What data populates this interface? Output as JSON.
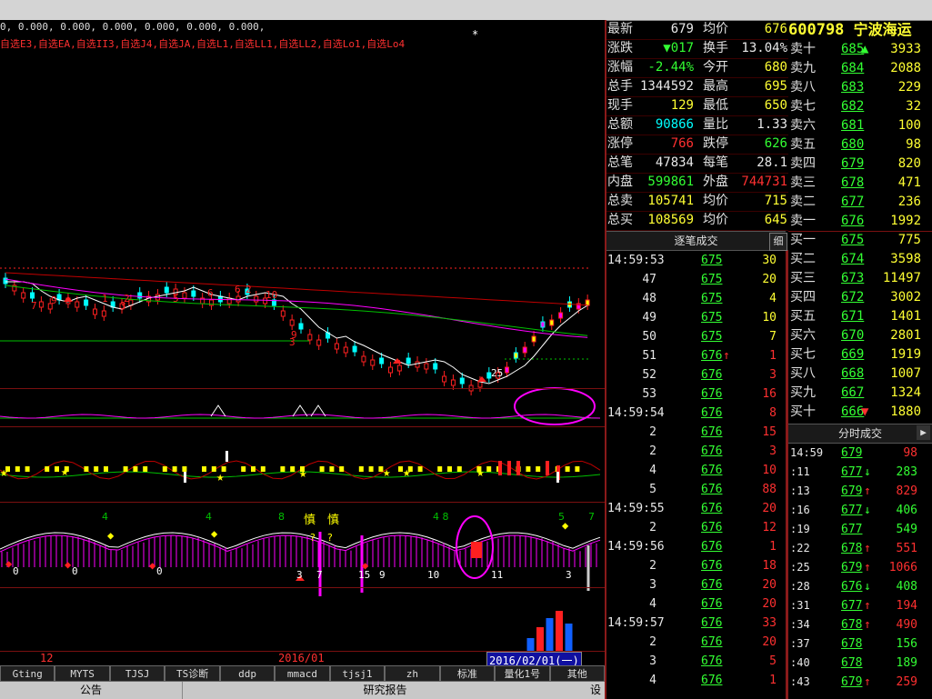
{
  "indicators": {
    "values_line": "0, 0.000, 0.000, 0.000, 0.000, 0.000, 0.000,",
    "names_line": "自选E3,自选EA,自选II3,自选J4,自选JA,自选L1,自选LL1,自选LL2,自选Lo1,自选Lo4",
    "marker": "*"
  },
  "chart": {
    "date_labels": [
      "12",
      "2016/01"
    ],
    "selected_date": "2016/02/01(一)",
    "candle_labels": [
      "7",
      "9",
      "6",
      "1",
      "2",
      "3",
      "5",
      "6",
      "2",
      "9",
      "3",
      "10",
      "25"
    ],
    "panel3_labels": [
      "4",
      "4",
      "8",
      "4 8",
      "5",
      "7",
      "慎",
      "慎",
      "?",
      "?"
    ],
    "panel3_bottom": [
      "0",
      "0",
      "0",
      "3",
      "7",
      "15",
      "9",
      "10",
      "11",
      "3"
    ],
    "colors": {
      "up": "#ff2020",
      "down": "#00ffff",
      "ma1": "#ffffff",
      "ma2": "#ff00ff",
      "ma3": "#00c000",
      "ma4": "#c00000",
      "highlight": "#ff00ff"
    }
  },
  "tabs": [
    "Gting",
    "MYTS",
    "TJSJ",
    "TS诊断",
    "ddp",
    "mmacd",
    "tjsj1",
    "zh",
    "标准",
    "量化1号",
    "其他"
  ],
  "bottom_tabs": [
    "公告",
    "研究报告"
  ],
  "settings": "设",
  "quote": {
    "rows": [
      {
        "l1": "最新",
        "v1": "679",
        "c1": "white",
        "l2": "均价",
        "v2": "676",
        "c2": "yellow"
      },
      {
        "l1": "涨跌",
        "v1": "▼017",
        "c1": "green",
        "l2": "换手",
        "v2": "13.04%",
        "c2": "white"
      },
      {
        "l1": "涨幅",
        "v1": "-2.44%",
        "c1": "green",
        "l2": "今开",
        "v2": "680",
        "c2": "yellow"
      },
      {
        "l1": "总手",
        "v1": "1344592",
        "c1": "white",
        "l2": "最高",
        "v2": "695",
        "c2": "yellow"
      },
      {
        "l1": "现手",
        "v1": "129",
        "c1": "yellow",
        "l2": "最低",
        "v2": "650",
        "c2": "yellow"
      },
      {
        "l1": "总额",
        "v1": "90866",
        "c1": "cyan",
        "l2": "量比",
        "v2": "1.33",
        "c2": "white"
      },
      {
        "l1": "涨停",
        "v1": "766",
        "c1": "red",
        "l2": "跌停",
        "v2": "626",
        "c2": "green"
      },
      {
        "l1": "总笔",
        "v1": "47834",
        "c1": "white",
        "l2": "每笔",
        "v2": "28.1",
        "c2": "white"
      },
      {
        "l1": "内盘",
        "v1": "599861",
        "c1": "green",
        "l2": "外盘",
        "v2": "744731",
        "c2": "red"
      },
      {
        "l1": "总卖",
        "v1": "105741",
        "c1": "yellow",
        "l2": "均价",
        "v2": "715",
        "c2": "yellow"
      },
      {
        "l1": "总买",
        "v1": "108569",
        "c1": "yellow",
        "l2": "均价",
        "v2": "645",
        "c2": "yellow"
      }
    ]
  },
  "stock": {
    "code": "600798",
    "name": "宁波海运"
  },
  "orderbook": {
    "sells": [
      {
        "label": "卖十",
        "price": "685",
        "arrow": "▲",
        "arrow_color": "green",
        "vol": "3933"
      },
      {
        "label": "卖九",
        "price": "684",
        "arrow": "",
        "vol": "2088"
      },
      {
        "label": "卖八",
        "price": "683",
        "arrow": "",
        "vol": "229"
      },
      {
        "label": "卖七",
        "price": "682",
        "arrow": "",
        "vol": "32"
      },
      {
        "label": "卖六",
        "price": "681",
        "arrow": "",
        "vol": "100"
      },
      {
        "label": "卖五",
        "price": "680",
        "arrow": "",
        "vol": "98"
      },
      {
        "label": "卖四",
        "price": "679",
        "arrow": "",
        "vol": "820"
      },
      {
        "label": "卖三",
        "price": "678",
        "arrow": "",
        "vol": "471"
      },
      {
        "label": "卖二",
        "price": "677",
        "arrow": "",
        "vol": "236"
      },
      {
        "label": "卖一",
        "price": "676",
        "arrow": "",
        "vol": "1992"
      }
    ],
    "buys": [
      {
        "label": "买一",
        "price": "675",
        "arrow": "",
        "vol": "775"
      },
      {
        "label": "买二",
        "price": "674",
        "arrow": "",
        "vol": "3598"
      },
      {
        "label": "买三",
        "price": "673",
        "arrow": "",
        "vol": "11497"
      },
      {
        "label": "买四",
        "price": "672",
        "arrow": "",
        "vol": "3002"
      },
      {
        "label": "买五",
        "price": "671",
        "arrow": "",
        "vol": "1401"
      },
      {
        "label": "买六",
        "price": "670",
        "arrow": "",
        "vol": "2801"
      },
      {
        "label": "买七",
        "price": "669",
        "arrow": "",
        "vol": "1919"
      },
      {
        "label": "买八",
        "price": "668",
        "arrow": "",
        "vol": "1007"
      },
      {
        "label": "买九",
        "price": "667",
        "arrow": "",
        "vol": "1324"
      },
      {
        "label": "买十",
        "price": "666",
        "arrow": "▼",
        "arrow_color": "red",
        "vol": "1880"
      }
    ]
  },
  "tick_panel": {
    "title": "逐笔成交",
    "detail": "细",
    "rows": [
      {
        "t": "14:59:53",
        "p": "675",
        "a": "",
        "v": "30",
        "vc": "yellow"
      },
      {
        "t": "47",
        "p": "675",
        "a": "",
        "v": "20",
        "vc": "yellow"
      },
      {
        "t": "48",
        "p": "675",
        "a": "",
        "v": "4",
        "vc": "yellow"
      },
      {
        "t": "49",
        "p": "675",
        "a": "",
        "v": "10",
        "vc": "yellow"
      },
      {
        "t": "50",
        "p": "675",
        "a": "",
        "v": "7",
        "vc": "yellow"
      },
      {
        "t": "51",
        "p": "676",
        "a": "↑",
        "v": "1",
        "vc": "red"
      },
      {
        "t": "52",
        "p": "676",
        "a": "",
        "v": "3",
        "vc": "red"
      },
      {
        "t": "53",
        "p": "676",
        "a": "",
        "v": "16",
        "vc": "red"
      },
      {
        "t": "14:59:54",
        "p": "676",
        "a": "",
        "v": "8",
        "vc": "red"
      },
      {
        "t": "2",
        "p": "676",
        "a": "",
        "v": "15",
        "vc": "red"
      },
      {
        "t": "2",
        "p": "676",
        "a": "",
        "v": "3",
        "vc": "red"
      },
      {
        "t": "4",
        "p": "676",
        "a": "",
        "v": "10",
        "vc": "red"
      },
      {
        "t": "5",
        "p": "676",
        "a": "",
        "v": "88",
        "vc": "red"
      },
      {
        "t": "14:59:55",
        "p": "676",
        "a": "",
        "v": "20",
        "vc": "red"
      },
      {
        "t": "2",
        "p": "676",
        "a": "",
        "v": "12",
        "vc": "red"
      },
      {
        "t": "14:59:56",
        "p": "676",
        "a": "",
        "v": "1",
        "vc": "red"
      },
      {
        "t": "2",
        "p": "676",
        "a": "",
        "v": "18",
        "vc": "red"
      },
      {
        "t": "3",
        "p": "676",
        "a": "",
        "v": "20",
        "vc": "red"
      },
      {
        "t": "4",
        "p": "676",
        "a": "",
        "v": "20",
        "vc": "red"
      },
      {
        "t": "14:59:57",
        "p": "676",
        "a": "",
        "v": "33",
        "vc": "red"
      },
      {
        "t": "2",
        "p": "676",
        "a": "",
        "v": "20",
        "vc": "red"
      },
      {
        "t": "3",
        "p": "676",
        "a": "",
        "v": "5",
        "vc": "red"
      },
      {
        "t": "4",
        "p": "676",
        "a": "",
        "v": "1",
        "vc": "red"
      }
    ]
  },
  "fenshi_panel": {
    "title": "分时成交",
    "rows": [
      {
        "t": "14:59",
        "p": "679",
        "a": "",
        "pc": "green",
        "v": "98",
        "vc": "red"
      },
      {
        "t": ":11",
        "p": "677",
        "a": "↓",
        "pc": "green",
        "v": "283",
        "vc": "green"
      },
      {
        "t": ":13",
        "p": "679",
        "a": "↑",
        "pc": "green",
        "v": "829",
        "vc": "red"
      },
      {
        "t": ":16",
        "p": "677",
        "a": "↓",
        "pc": "green",
        "v": "406",
        "vc": "green"
      },
      {
        "t": ":19",
        "p": "677",
        "a": "",
        "pc": "green",
        "v": "549",
        "vc": "green"
      },
      {
        "t": ":22",
        "p": "678",
        "a": "↑",
        "pc": "green",
        "v": "551",
        "vc": "red"
      },
      {
        "t": ":25",
        "p": "679",
        "a": "↑",
        "pc": "green",
        "v": "1066",
        "vc": "red"
      },
      {
        "t": ":28",
        "p": "676",
        "a": "↓",
        "pc": "green",
        "v": "408",
        "vc": "green"
      },
      {
        "t": ":31",
        "p": "677",
        "a": "↑",
        "pc": "green",
        "v": "194",
        "vc": "red"
      },
      {
        "t": ":34",
        "p": "678",
        "a": "↑",
        "pc": "green",
        "v": "490",
        "vc": "red"
      },
      {
        "t": ":37",
        "p": "678",
        "a": "",
        "pc": "green",
        "v": "156",
        "vc": "green"
      },
      {
        "t": ":40",
        "p": "678",
        "a": "",
        "pc": "green",
        "v": "189",
        "vc": "green"
      },
      {
        "t": ":43",
        "p": "679",
        "a": "↑",
        "pc": "green",
        "v": "259",
        "vc": "red"
      }
    ]
  }
}
